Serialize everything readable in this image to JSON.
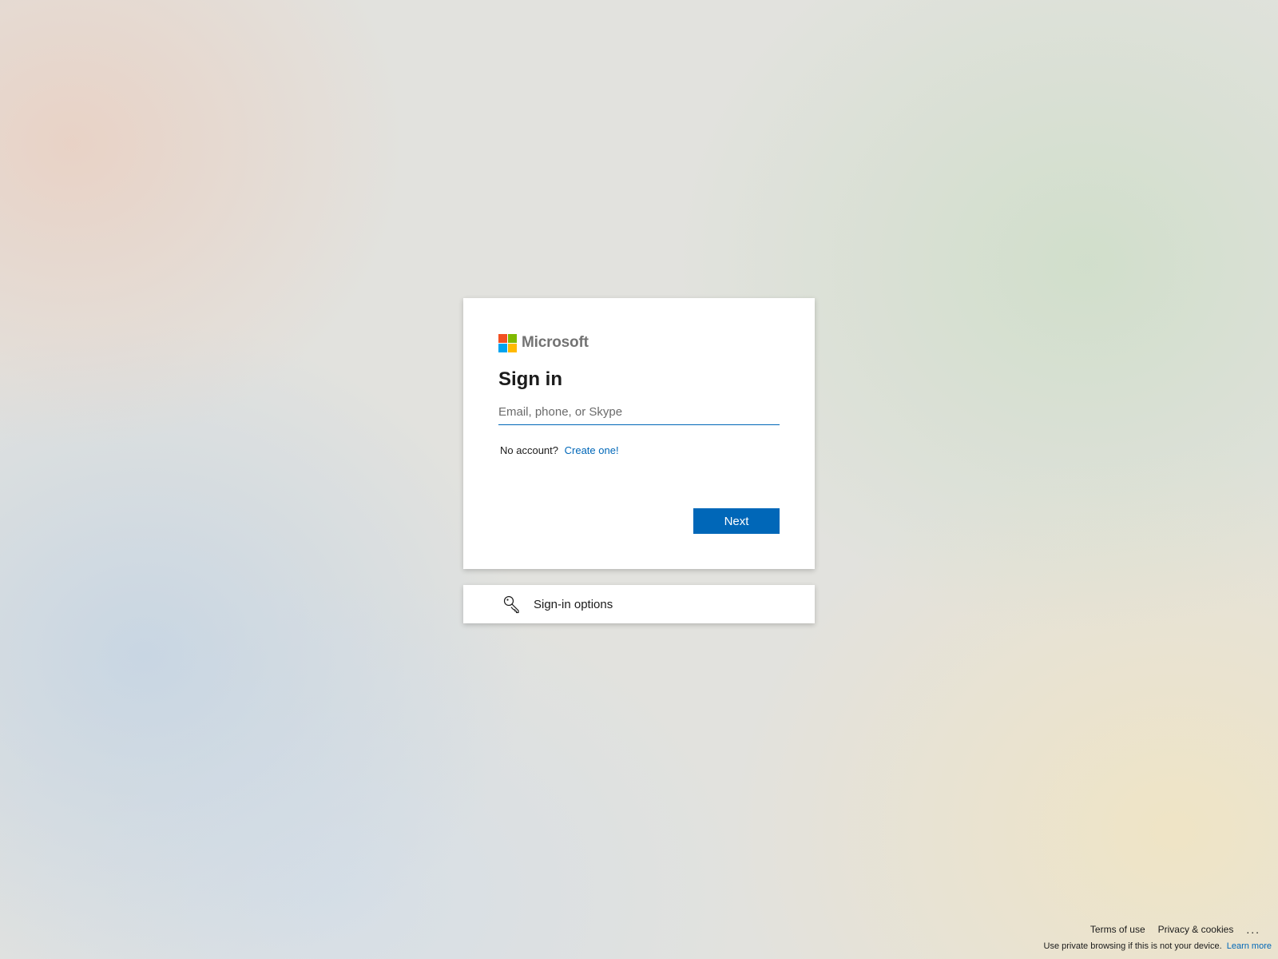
{
  "brand": {
    "name": "Microsoft",
    "colors": [
      "#f25022",
      "#7fba00",
      "#00a4ef",
      "#ffb900"
    ],
    "accent": "#0067b8"
  },
  "signin": {
    "title": "Sign in",
    "email_placeholder": "Email, phone, or Skype",
    "email_value": "",
    "no_account_text": "No account?",
    "create_link": "Create one!",
    "next_label": "Next"
  },
  "options": {
    "icon": "key-icon",
    "label": "Sign-in options"
  },
  "footer": {
    "terms": "Terms of use",
    "privacy": "Privacy & cookies",
    "more": "...",
    "private_note": "Use private browsing if this is not your device.",
    "learn_more": "Learn more"
  }
}
